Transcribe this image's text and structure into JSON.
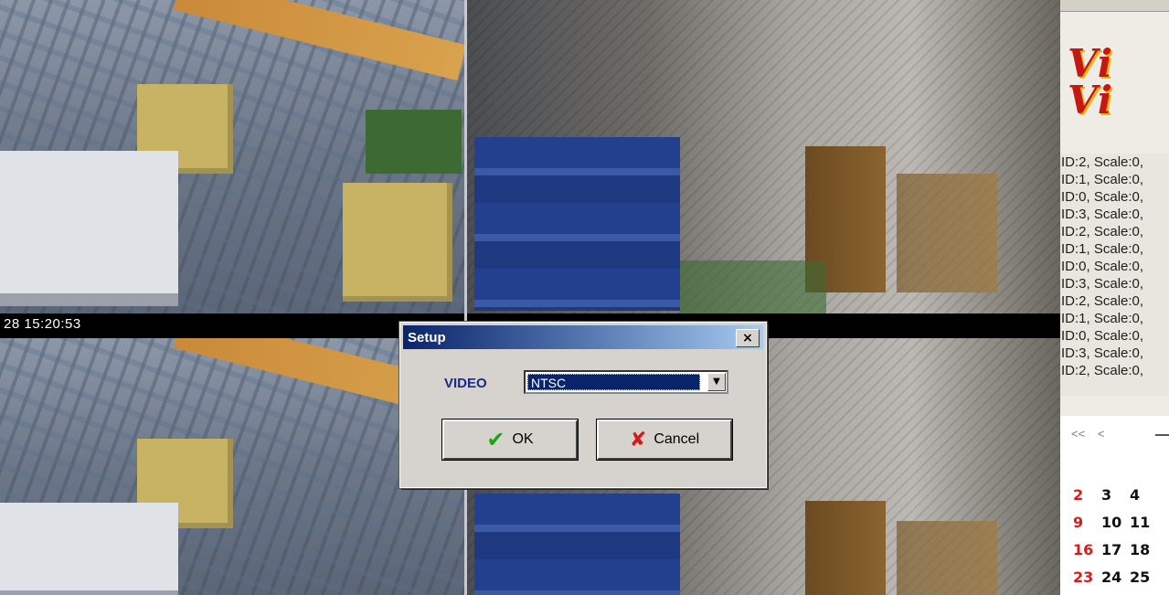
{
  "camera": {
    "timestamp": "28 15:20:53"
  },
  "side_panel": {
    "logo_text": [
      "Vi",
      "Vi"
    ],
    "log_lines": [
      "ID:2, Scale:0,",
      "ID:1, Scale:0,",
      "ID:0, Scale:0,",
      "ID:3, Scale:0,",
      "ID:2, Scale:0,",
      "ID:1, Scale:0,",
      "ID:0, Scale:0,",
      "ID:3, Scale:0,",
      "ID:2, Scale:0,",
      "ID:1, Scale:0,",
      "ID:0, Scale:0,",
      "ID:3, Scale:0,",
      "ID:2, Scale:0,"
    ],
    "calendar": {
      "nav_prev_year": "<<",
      "nav_prev_month": "<",
      "rows": [
        [
          "2",
          "3",
          "4"
        ],
        [
          "9",
          "10",
          "11"
        ],
        [
          "16",
          "17",
          "18"
        ],
        [
          "23",
          "24",
          "25"
        ]
      ]
    }
  },
  "dialog": {
    "title": "Setup",
    "close_label": "×",
    "video_label": "VIDEO",
    "video_select_value": "NTSC",
    "ok_label": "OK",
    "cancel_label": "Cancel"
  },
  "colors": {
    "title_gradient_start": "#0a246a",
    "title_gradient_end": "#a6caf0",
    "ok_icon": "#1aa51a",
    "cancel_icon": "#d41a1a",
    "calendar_sunday": "#d81b1b"
  },
  "icons": {
    "ok": "check-icon",
    "cancel": "x-icon",
    "dropdown": "chevron-down-icon",
    "close": "close-icon"
  }
}
